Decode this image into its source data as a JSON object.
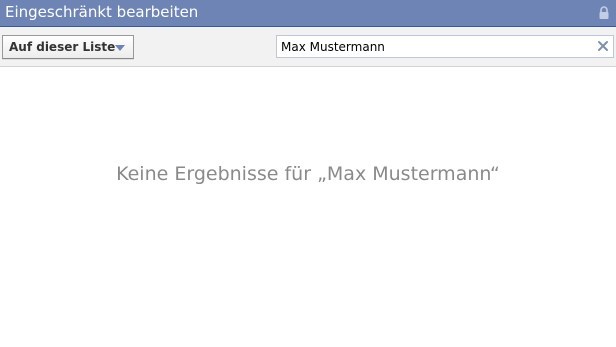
{
  "titlebar": {
    "title": "Eingeschränkt bearbeiten",
    "lock_icon": "lock-icon"
  },
  "toolbar": {
    "filter_label": "Auf dieser Liste",
    "filter_icon": "chevron-down-icon",
    "search_value": "Max Mustermann",
    "clear_icon": "close-icon"
  },
  "results": {
    "empty_message": "Keine Ergebnisse für „Max Mustermann“"
  },
  "colors": {
    "titlebar": "#6d84b4",
    "toolbar": "#f2f2f2",
    "empty_text": "#8a8a8a"
  }
}
